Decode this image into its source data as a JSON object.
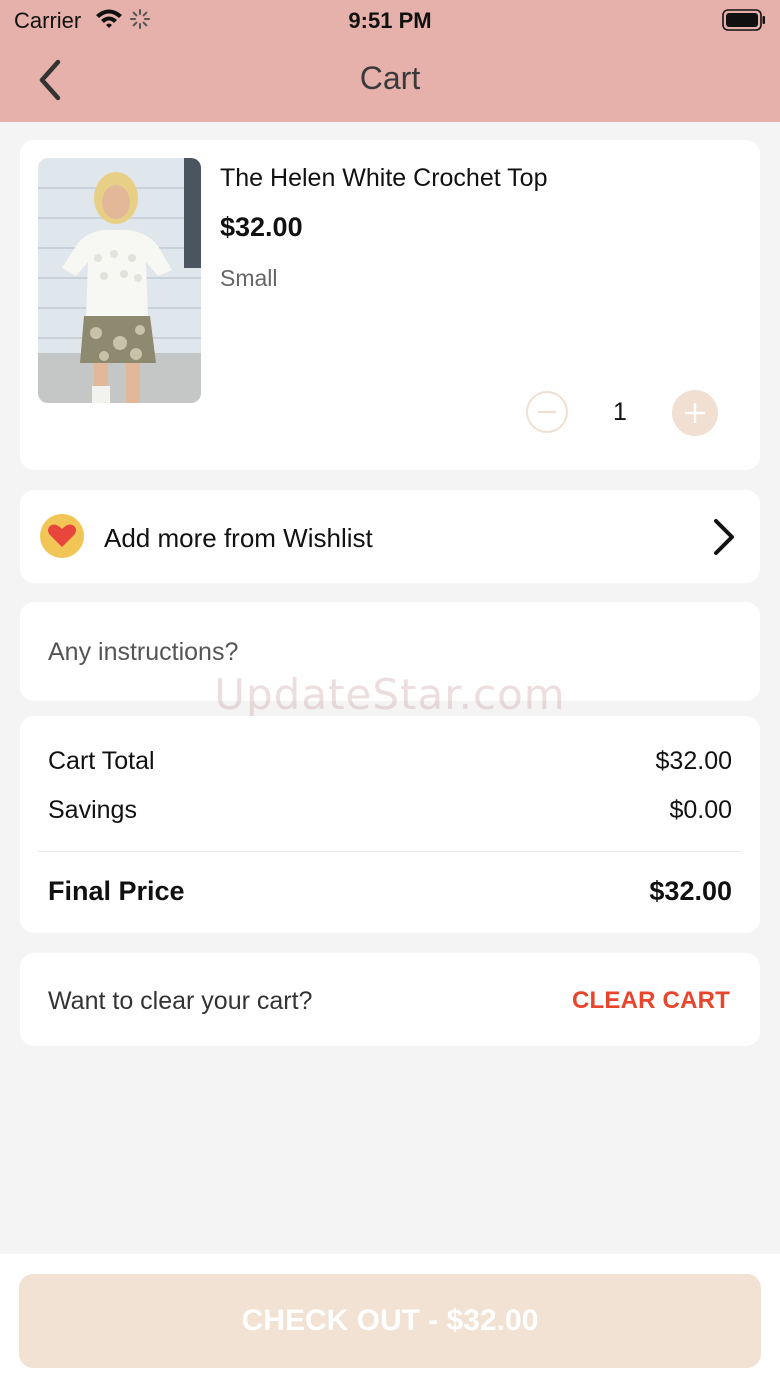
{
  "status_bar": {
    "carrier": "Carrier",
    "time": "9:51 PM"
  },
  "nav": {
    "title": "Cart",
    "back_icon": "chevron-left-icon"
  },
  "cart_item": {
    "name": "The Helen White Crochet Top",
    "price": "$32.00",
    "size": "Small",
    "quantity": "1"
  },
  "wishlist": {
    "label": "Add more from Wishlist",
    "icon": "heart-icon",
    "icon_color": "#f1c657"
  },
  "instructions": {
    "placeholder": "Any instructions?"
  },
  "watermark": "UpdateStar.com",
  "summary": {
    "cart_total_label": "Cart Total",
    "cart_total_value": "$32.00",
    "savings_label": "Savings",
    "savings_value": "$0.00",
    "final_label": "Final Price",
    "final_value": "$32.00"
  },
  "clear": {
    "prompt": "Want to clear your cart?",
    "button_label": "CLEAR CART",
    "button_color": "#e8452c"
  },
  "checkout": {
    "label": "CHECK OUT - $32.00"
  },
  "colors": {
    "header_bg": "#e6b1aa",
    "accent_light": "#f1e2d3",
    "page_bg": "#f4f4f4"
  }
}
